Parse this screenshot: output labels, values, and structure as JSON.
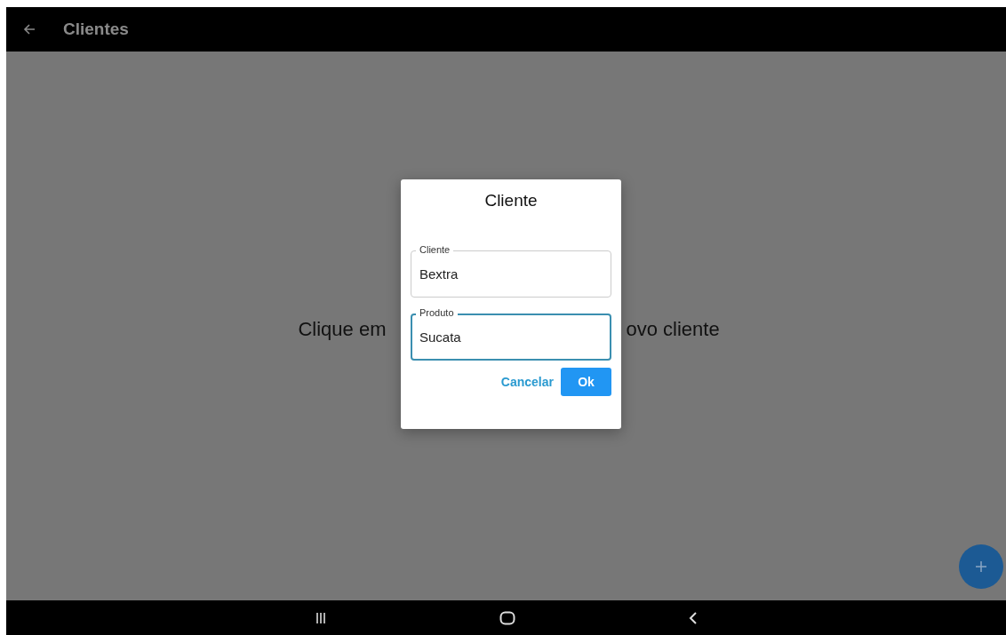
{
  "app_bar": {
    "title": "Clientes"
  },
  "background_message": {
    "left": "Clique em",
    "right": "ovo cliente"
  },
  "dialog": {
    "title": "Cliente",
    "fields": [
      {
        "label": "Cliente",
        "value": "Bextra",
        "focused": false
      },
      {
        "label": "Produto",
        "value": "Sucata",
        "focused": true
      }
    ],
    "buttons": [
      {
        "label": "Cancelar",
        "kind": "text"
      },
      {
        "label": "Ok",
        "kind": "filled"
      }
    ]
  }
}
